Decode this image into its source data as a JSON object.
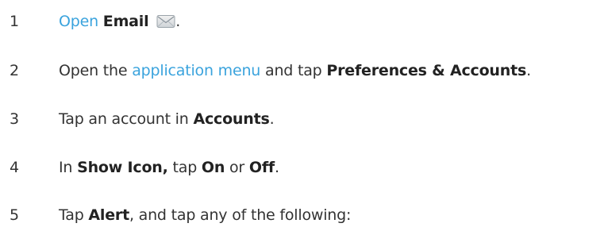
{
  "steps": [
    {
      "number": "1",
      "parts": [
        {
          "text": "Open",
          "style": "link"
        },
        {
          "text": " ",
          "style": "plain"
        },
        {
          "text": "Email",
          "style": "bold"
        },
        {
          "text": ".",
          "style": "plain"
        }
      ],
      "icon": "email-envelope-icon"
    },
    {
      "number": "2",
      "parts": [
        {
          "text": "Open the ",
          "style": "plain"
        },
        {
          "text": "application menu",
          "style": "link"
        },
        {
          "text": " and tap ",
          "style": "plain"
        },
        {
          "text": "Preferences & Accounts",
          "style": "bold"
        },
        {
          "text": ".",
          "style": "plain"
        }
      ]
    },
    {
      "number": "3",
      "parts": [
        {
          "text": "Tap an account in ",
          "style": "plain"
        },
        {
          "text": "Accounts",
          "style": "bold"
        },
        {
          "text": ".",
          "style": "plain"
        }
      ]
    },
    {
      "number": "4",
      "parts": [
        {
          "text": "In ",
          "style": "plain"
        },
        {
          "text": "Show Icon,",
          "style": "bold"
        },
        {
          "text": " tap ",
          "style": "plain"
        },
        {
          "text": "On",
          "style": "bold"
        },
        {
          "text": " or ",
          "style": "plain"
        },
        {
          "text": "Off",
          "style": "bold"
        },
        {
          "text": ".",
          "style": "plain"
        }
      ]
    },
    {
      "number": "5",
      "parts": [
        {
          "text": "Tap ",
          "style": "plain"
        },
        {
          "text": "Alert",
          "style": "bold"
        },
        {
          "text": ", and tap any of the following:",
          "style": "plain"
        }
      ]
    }
  ],
  "colors": {
    "link": "#3aa3dd",
    "text": "#333333"
  }
}
